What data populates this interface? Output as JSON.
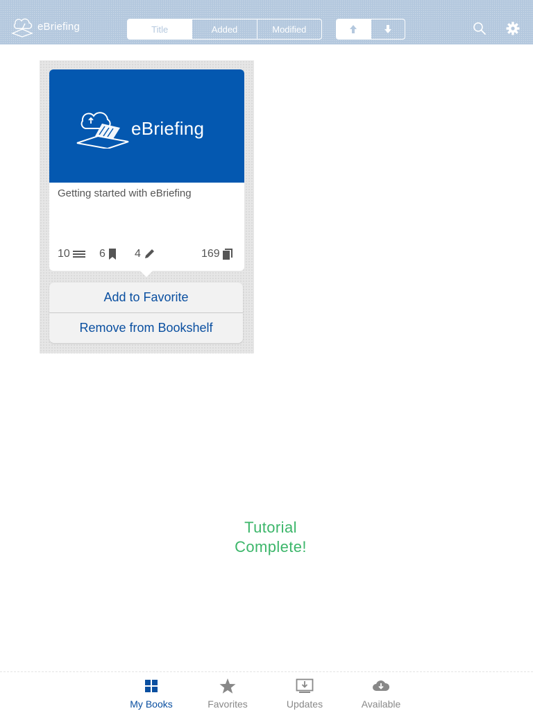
{
  "header": {
    "brand_name": "eBriefing",
    "sort_tabs": [
      {
        "label": "Title",
        "active": true
      },
      {
        "label": "Added",
        "active": false
      },
      {
        "label": "Modified",
        "active": false
      }
    ],
    "order_buttons": [
      {
        "icon": "arrow-up-icon"
      },
      {
        "icon": "arrow-down-icon"
      }
    ],
    "icons": [
      "search-icon",
      "gear-icon"
    ]
  },
  "book": {
    "cover_title": "eBriefing",
    "title": "Getting started with eBriefing",
    "chapters": "10",
    "bookmarks": "6",
    "notes": "4",
    "pages": "169"
  },
  "menu": {
    "add_favorite": "Add to Favorite",
    "remove_bookshelf": "Remove from Bookshelf"
  },
  "tutorial": {
    "line1": "Tutorial",
    "line2": "Complete!"
  },
  "tabs": [
    {
      "label": "My Books",
      "icon": "grid-icon",
      "active": true
    },
    {
      "label": "Favorites",
      "icon": "star-icon",
      "active": false
    },
    {
      "label": "Updates",
      "icon": "updates-icon",
      "active": false
    },
    {
      "label": "Available",
      "icon": "cloud-download-icon",
      "active": false
    }
  ],
  "colors": {
    "header_bg": "#b4c8de",
    "cover_blue": "#0458b0",
    "link_blue": "#0a4fa0",
    "tutorial_green": "#3cb66a"
  }
}
